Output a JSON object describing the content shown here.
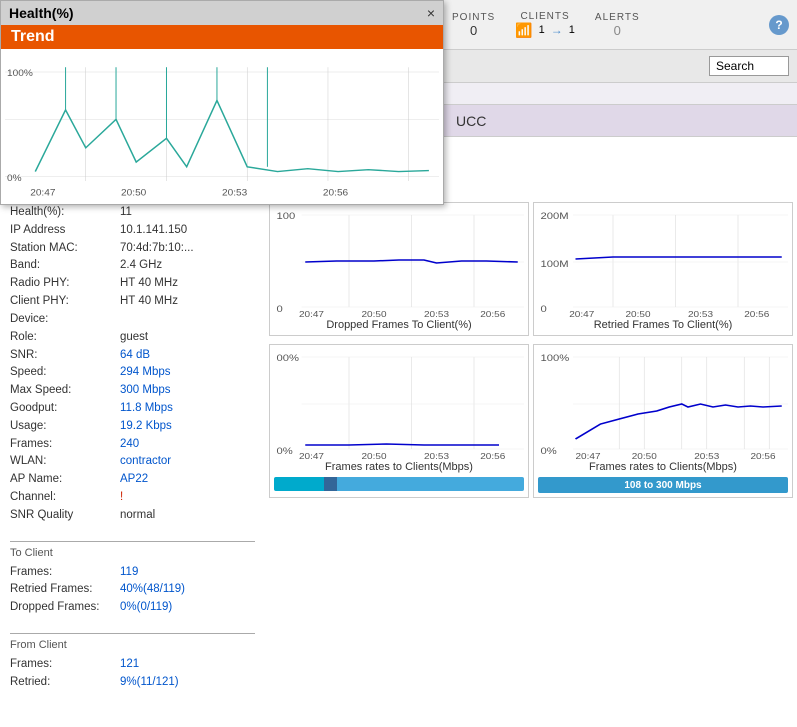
{
  "header": {
    "points_label": "POINTS",
    "points_value": "0",
    "clients_label": "CLIENTS",
    "clients_wifi": "1",
    "clients_eth": "1",
    "alerts_label": "ALERTS",
    "alerts_value": "0",
    "search_placeholder": "Search",
    "search_button_label": "Search",
    "ucc_label": "UCC"
  },
  "health_panel": {
    "title": "Health(%)",
    "close_label": "×",
    "trend_label": "Trend",
    "y_max": "100%",
    "y_min": "0%",
    "times": [
      "20:47",
      "20:50",
      "20:53",
      "20:56"
    ]
  },
  "info": {
    "health_label": "Health(%):",
    "health_val": "11",
    "ip_label": "IP Address",
    "ip_val": "10.1.141.150",
    "mac_label": "Station MAC:",
    "mac_val": "70:4d:7b:10:...",
    "band_label": "Band:",
    "band_val": "2.4 GHz",
    "radio_phy_label": "Radio PHY:",
    "radio_phy_val": "HT 40 MHz",
    "client_phy_label": "Client PHY:",
    "client_phy_val": "HT 40 MHz",
    "device_label": "Device:",
    "device_val": "",
    "role_label": "Role:",
    "role_val": "guest",
    "snr_label": "SNR:",
    "snr_val": "64 dB",
    "speed_label": "Speed:",
    "speed_val": "294 Mbps",
    "max_speed_label": "Max Speed:",
    "max_speed_val": "300 Mbps",
    "goodput_label": "Goodput:",
    "goodput_val": "11.8 Mbps",
    "usage_label": "Usage:",
    "usage_val": "19.2 Kbps",
    "frames_label": "Frames:",
    "frames_val": "240",
    "wlan_label": "WLAN:",
    "wlan_val": "contractor",
    "ap_label": "AP Name:",
    "ap_val": "AP22",
    "channel_label": "Channel:",
    "channel_val": "!",
    "snr_quality_label": "SNR Quality",
    "snr_quality_val": "normal",
    "to_client_title": "To Client",
    "to_client_frames_label": "Frames:",
    "to_client_frames_val": "119",
    "to_client_retried_label": "Retried Frames:",
    "to_client_retried_val": "40%(48/119)",
    "to_client_dropped_label": "Dropped Frames:",
    "to_client_dropped_val": "0%(0/119)",
    "from_client_title": "From Client",
    "from_client_frames_label": "Frames:",
    "from_client_frames_val": "121",
    "from_client_retried_label": "Retried:",
    "from_client_retried_val": "9%(11/121)"
  },
  "charts": {
    "dropped_title": "Dropped Frames To Client(%)",
    "retried_title": "Retried Frames To Client(%)",
    "frames_rate_client_title": "Frames rates to Clients(Mbps)",
    "frames_rate_client2_title": "Frames rates to Clients(Mbps)",
    "speed_range_label": "108 to 300 Mbps",
    "times": [
      "20:47",
      "20:50",
      "20:53",
      "20:56"
    ],
    "dropped_y_max": "100",
    "dropped_y_min": "0",
    "retried_y_max": "200M",
    "retried_y_min": "0",
    "frames_y_max": "00%",
    "frames_y_min": "0%"
  }
}
